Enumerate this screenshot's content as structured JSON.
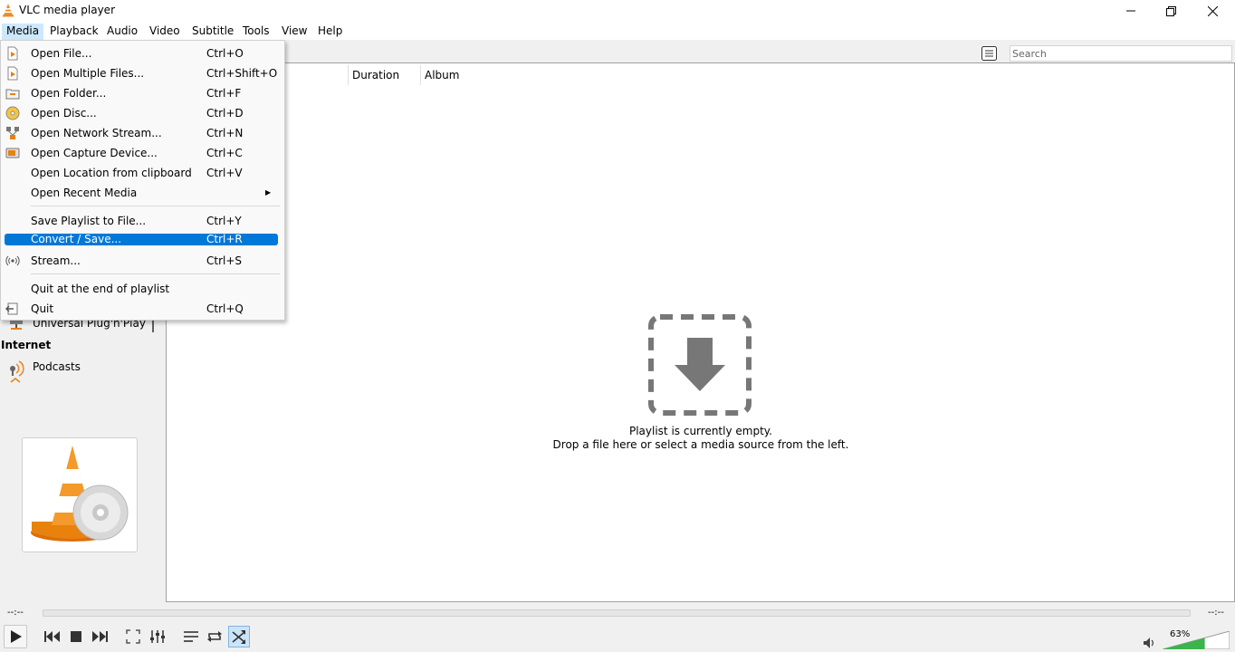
{
  "window": {
    "title": "VLC media player"
  },
  "menubar": {
    "items": [
      "Media",
      "Playback",
      "Audio",
      "Video",
      "Subtitle",
      "Tools",
      "View",
      "Help"
    ]
  },
  "search": {
    "placeholder": "Search",
    "value": ""
  },
  "playlist": {
    "columns": [
      "Duration",
      "Album"
    ],
    "empty_line1": "Playlist is currently empty.",
    "empty_line2": "Drop a file here or select a media source from the left."
  },
  "sidebar": {
    "upnp_label": "Universal Plug'n'Play",
    "internet_heading": "Internet",
    "podcasts_label": "Podcasts"
  },
  "media_menu": {
    "items": [
      {
        "label": "Open File...",
        "shortcut": "Ctrl+O",
        "icon": "open-file-icon"
      },
      {
        "label": "Open Multiple Files...",
        "shortcut": "Ctrl+Shift+O",
        "icon": "open-multiple-icon"
      },
      {
        "label": "Open Folder...",
        "shortcut": "Ctrl+F",
        "icon": "folder-icon"
      },
      {
        "label": "Open Disc...",
        "shortcut": "Ctrl+D",
        "icon": "disc-icon"
      },
      {
        "label": "Open Network Stream...",
        "shortcut": "Ctrl+N",
        "icon": "network-icon"
      },
      {
        "label": "Open Capture Device...",
        "shortcut": "Ctrl+C",
        "icon": "capture-device-icon"
      },
      {
        "label": "Open Location from clipboard",
        "shortcut": "Ctrl+V",
        "icon": ""
      },
      {
        "label": "Open Recent Media",
        "shortcut": "",
        "icon": ""
      },
      {
        "label": "Save Playlist to File...",
        "shortcut": "Ctrl+Y",
        "icon": ""
      },
      {
        "label": "Convert / Save...",
        "shortcut": "Ctrl+R",
        "icon": ""
      },
      {
        "label": "Stream...",
        "shortcut": "Ctrl+S",
        "icon": "stream-icon"
      },
      {
        "label": "Quit at the end of playlist",
        "shortcut": "",
        "icon": ""
      },
      {
        "label": "Quit",
        "shortcut": "Ctrl+Q",
        "icon": "quit-icon"
      }
    ],
    "highlighted": "Convert / Save..."
  },
  "controls": {
    "time_elapsed": "--:--",
    "time_total": "--:--",
    "volume_label": "63%",
    "volume_fraction": 0.63,
    "random_active": true
  },
  "colors": {
    "highlight": "#0078d7",
    "volume_fill": "#3cb44b",
    "vlc_orange": "#f08a24"
  }
}
